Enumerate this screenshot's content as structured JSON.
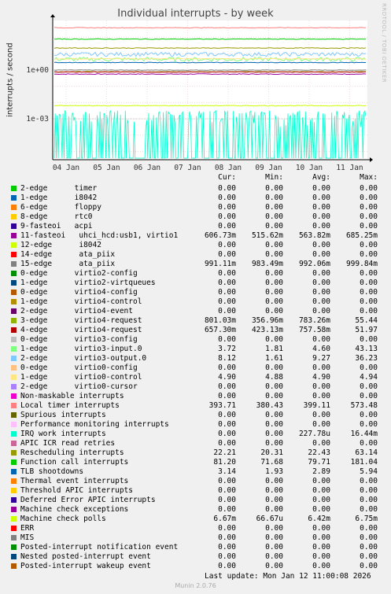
{
  "chart_data": {
    "type": "line",
    "title": "Individual interrupts - by week",
    "ylabel": "interrupts / second",
    "yscale": "log",
    "yticks": [
      "1e+00",
      "1e-03"
    ],
    "xticks": [
      "04 Jan",
      "05 Jan",
      "06 Jan",
      "07 Jan",
      "08 Jan",
      "09 Jan",
      "10 Jan",
      "11 Jan"
    ],
    "grid": true,
    "watermark": "RRDTOOL / TOBI OETIKER",
    "columns": [
      "Cur:",
      "Min:",
      "Avg:",
      "Max:"
    ],
    "series": [
      {
        "name": "2-edge      timer",
        "color": "#00cc00",
        "cur": "0.00",
        "min": "0.00",
        "avg": "0.00",
        "max": "0.00"
      },
      {
        "name": "1-edge      i8042",
        "color": "#0066b3",
        "cur": "0.00",
        "min": "0.00",
        "avg": "0.00",
        "max": "0.00"
      },
      {
        "name": "6-edge      floppy",
        "color": "#ff8000",
        "cur": "0.00",
        "min": "0.00",
        "avg": "0.00",
        "max": "0.00"
      },
      {
        "name": "8-edge      rtc0",
        "color": "#ffcc00",
        "cur": "0.00",
        "min": "0.00",
        "avg": "0.00",
        "max": "0.00"
      },
      {
        "name": "9-fasteoi   acpi",
        "color": "#330099",
        "cur": "0.00",
        "min": "0.00",
        "avg": "0.00",
        "max": "0.00"
      },
      {
        "name": "11-fasteoi   uhci_hcd:usb1, virtio1",
        "color": "#990099",
        "cur": "606.73m",
        "min": "515.62m",
        "avg": "563.82m",
        "max": "685.25m"
      },
      {
        "name": "12-edge      i8042",
        "color": "#ccff00",
        "cur": "0.00",
        "min": "0.00",
        "avg": "0.00",
        "max": "0.00"
      },
      {
        "name": "14-edge      ata_piix",
        "color": "#ff0000",
        "cur": "0.00",
        "min": "0.00",
        "avg": "0.00",
        "max": "0.00"
      },
      {
        "name": "15-edge      ata_piix",
        "color": "#808080",
        "cur": "991.11m",
        "min": "983.49m",
        "avg": "992.06m",
        "max": "999.84m"
      },
      {
        "name": "0-edge      virtio2-config",
        "color": "#008f00",
        "cur": "0.00",
        "min": "0.00",
        "avg": "0.00",
        "max": "0.00"
      },
      {
        "name": "1-edge      virtio2-virtqueues",
        "color": "#00487d",
        "cur": "0.00",
        "min": "0.00",
        "avg": "0.00",
        "max": "0.00"
      },
      {
        "name": "0-edge      virtio4-config",
        "color": "#b35a00",
        "cur": "0.00",
        "min": "0.00",
        "avg": "0.00",
        "max": "0.00"
      },
      {
        "name": "1-edge      virtio4-control",
        "color": "#b38f00",
        "cur": "0.00",
        "min": "0.00",
        "avg": "0.00",
        "max": "0.00"
      },
      {
        "name": "2-edge      virtio4-event",
        "color": "#6b006b",
        "cur": "0.00",
        "min": "0.00",
        "avg": "0.00",
        "max": "0.00"
      },
      {
        "name": "3-edge      virtio4-request",
        "color": "#8fb300",
        "cur": "801.03m",
        "min": "356.96m",
        "avg": "783.26m",
        "max": "55.44"
      },
      {
        "name": "4-edge      virtio4-request",
        "color": "#b30000",
        "cur": "657.30m",
        "min": "423.13m",
        "avg": "757.58m",
        "max": "51.97"
      },
      {
        "name": "0-edge      virtio3-config",
        "color": "#bebebe",
        "cur": "0.00",
        "min": "0.00",
        "avg": "0.00",
        "max": "0.00"
      },
      {
        "name": "1-edge      virtio3-input.0",
        "color": "#80ff80",
        "cur": "3.72",
        "min": "1.81",
        "avg": "4.60",
        "max": "43.13"
      },
      {
        "name": "2-edge      virtio3-output.0",
        "color": "#80c9ff",
        "cur": "8.12",
        "min": "1.61",
        "avg": "9.27",
        "max": "36.23"
      },
      {
        "name": "0-edge      virtio0-config",
        "color": "#ffc080",
        "cur": "0.00",
        "min": "0.00",
        "avg": "0.00",
        "max": "0.00"
      },
      {
        "name": "1-edge      virtio0-control",
        "color": "#ffe680",
        "cur": "4.90",
        "min": "4.88",
        "avg": "4.90",
        "max": "4.94"
      },
      {
        "name": "2-edge      virtio0-cursor",
        "color": "#aa80ff",
        "cur": "0.00",
        "min": "0.00",
        "avg": "0.00",
        "max": "0.00"
      },
      {
        "name": "Non-maskable interrupts",
        "color": "#ee00cc",
        "cur": "0.00",
        "min": "0.00",
        "avg": "0.00",
        "max": "0.00"
      },
      {
        "name": "Local timer interrupts",
        "color": "#ff8080",
        "cur": "393.71",
        "min": "380.43",
        "avg": "399.11",
        "max": "573.48"
      },
      {
        "name": "Spurious interrupts",
        "color": "#666600",
        "cur": "0.00",
        "min": "0.00",
        "avg": "0.00",
        "max": "0.00"
      },
      {
        "name": "Performance monitoring interrupts",
        "color": "#ffbfff",
        "cur": "0.00",
        "min": "0.00",
        "avg": "0.00",
        "max": "0.00"
      },
      {
        "name": "IRQ work interrupts",
        "color": "#00ffcc",
        "cur": "0.00",
        "min": "0.00",
        "avg": "227.78u",
        "max": "16.44m"
      },
      {
        "name": "APIC ICR read retries",
        "color": "#cc6699",
        "cur": "0.00",
        "min": "0.00",
        "avg": "0.00",
        "max": "0.00"
      },
      {
        "name": "Rescheduling interrupts",
        "color": "#999900",
        "cur": "22.21",
        "min": "20.31",
        "avg": "22.43",
        "max": "63.14"
      },
      {
        "name": "Function call interrupts",
        "color": "#00cc00",
        "cur": "81.20",
        "min": "71.68",
        "avg": "79.71",
        "max": "181.04"
      },
      {
        "name": "TLB shootdowns",
        "color": "#0066b3",
        "cur": "3.14",
        "min": "1.93",
        "avg": "2.89",
        "max": "5.94"
      },
      {
        "name": "Thermal event interrupts",
        "color": "#ff8000",
        "cur": "0.00",
        "min": "0.00",
        "avg": "0.00",
        "max": "0.00"
      },
      {
        "name": "Threshold APIC interrupts",
        "color": "#ffcc00",
        "cur": "0.00",
        "min": "0.00",
        "avg": "0.00",
        "max": "0.00"
      },
      {
        "name": "Deferred Error APIC interrupts",
        "color": "#330099",
        "cur": "0.00",
        "min": "0.00",
        "avg": "0.00",
        "max": "0.00"
      },
      {
        "name": "Machine check exceptions",
        "color": "#990099",
        "cur": "0.00",
        "min": "0.00",
        "avg": "0.00",
        "max": "0.00"
      },
      {
        "name": "Machine check polls",
        "color": "#ccff00",
        "cur": "6.67m",
        "min": "66.67u",
        "avg": "6.42m",
        "max": "6.75m"
      },
      {
        "name": "ERR",
        "color": "#ff0000",
        "cur": "0.00",
        "min": "0.00",
        "avg": "0.00",
        "max": "0.00"
      },
      {
        "name": "MIS",
        "color": "#808080",
        "cur": "0.00",
        "min": "0.00",
        "avg": "0.00",
        "max": "0.00"
      },
      {
        "name": "Posted-interrupt notification event",
        "color": "#008f00",
        "cur": "0.00",
        "min": "0.00",
        "avg": "0.00",
        "max": "0.00"
      },
      {
        "name": "Nested posted-interrupt event",
        "color": "#00487d",
        "cur": "0.00",
        "min": "0.00",
        "avg": "0.00",
        "max": "0.00"
      },
      {
        "name": "Posted-interrupt wakeup event",
        "color": "#b35a00",
        "cur": "0.00",
        "min": "0.00",
        "avg": "0.00",
        "max": "0.00"
      }
    ]
  },
  "footer": {
    "last_update": "Last update: Mon Jan 12 11:00:08 2026",
    "munin": "Munin 2.0.76"
  }
}
